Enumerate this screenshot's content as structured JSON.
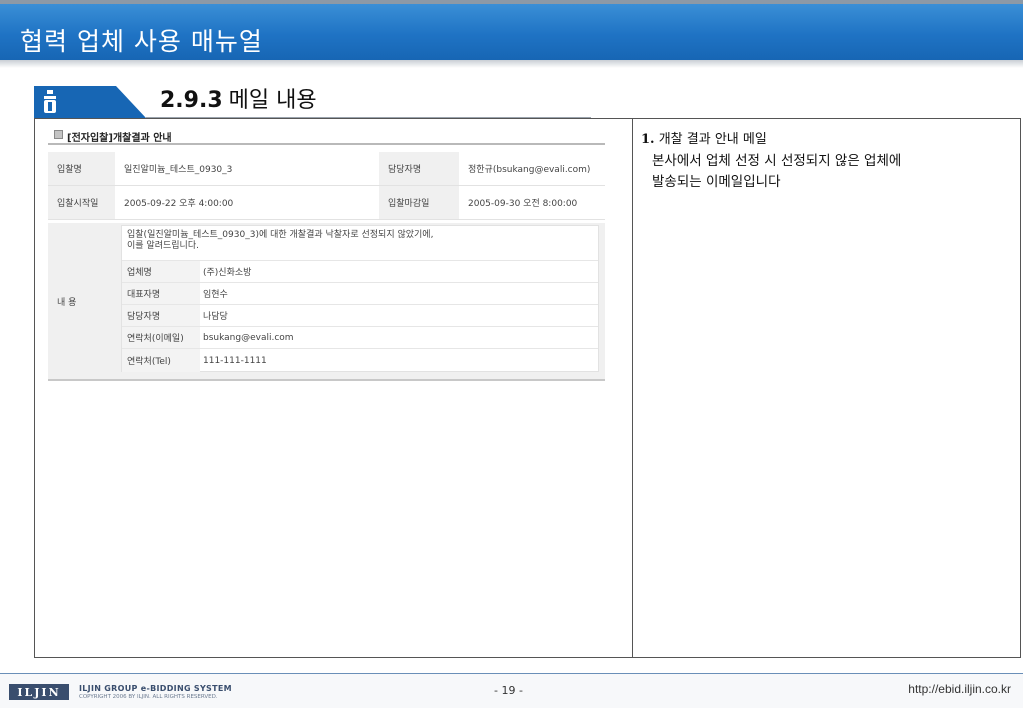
{
  "header": {
    "title": "협력 업체 사용 매뉴얼"
  },
  "section": {
    "number": "2.9.3",
    "title": "메일 내용"
  },
  "mail": {
    "heading": "[전자입찰]개찰결과 안내",
    "fields": [
      {
        "label": "입찰명",
        "value": "일진알미늄_테스트_0930_3"
      },
      {
        "label": "담당자명",
        "value": "정한규(bsukang@evali.com)"
      },
      {
        "label": "입찰시작일",
        "value": "2005-09-22 오후 4:00:00"
      },
      {
        "label": "입찰마감일",
        "value": "2005-09-30 오전 8:00:00"
      }
    ],
    "content_label": "내 용",
    "message_line1": "입찰(일진알미늄_테스트_0930_3)에 대한 개찰결과 낙찰자로 선정되지 않았기에,",
    "message_line2": "이를 알려드립니다.",
    "details": [
      {
        "label": "업체명",
        "value": "(주)신화소방"
      },
      {
        "label": "대표자명",
        "value": "임현수"
      },
      {
        "label": "담당자명",
        "value": "나담당"
      },
      {
        "label": "연락처(이메일)",
        "value": "bsukang@evali.com"
      },
      {
        "label": "연락처(Tel)",
        "value": "111-111-1111"
      }
    ]
  },
  "note": {
    "number": "1.",
    "title": "개찰 결과 안내 메일",
    "line1": "본사에서 업체 선정 시 선정되지 않은 업체에",
    "line2": "발송되는 이메일입니다"
  },
  "footer": {
    "logo": "ILJIN",
    "brand_line": "ILJIN GROUP e-BIDDING SYSTEM",
    "copyright": "COPYRIGHT 2006 BY ILJIN. ALL RIGHTS RESERVED.",
    "page": "- 19 -",
    "url": "http://ebid.iljin.co.kr"
  },
  "colors": {
    "header_blue": "#1f73c4",
    "section_tab": "#1766b4",
    "logo_navy": "#3a4e6e"
  }
}
